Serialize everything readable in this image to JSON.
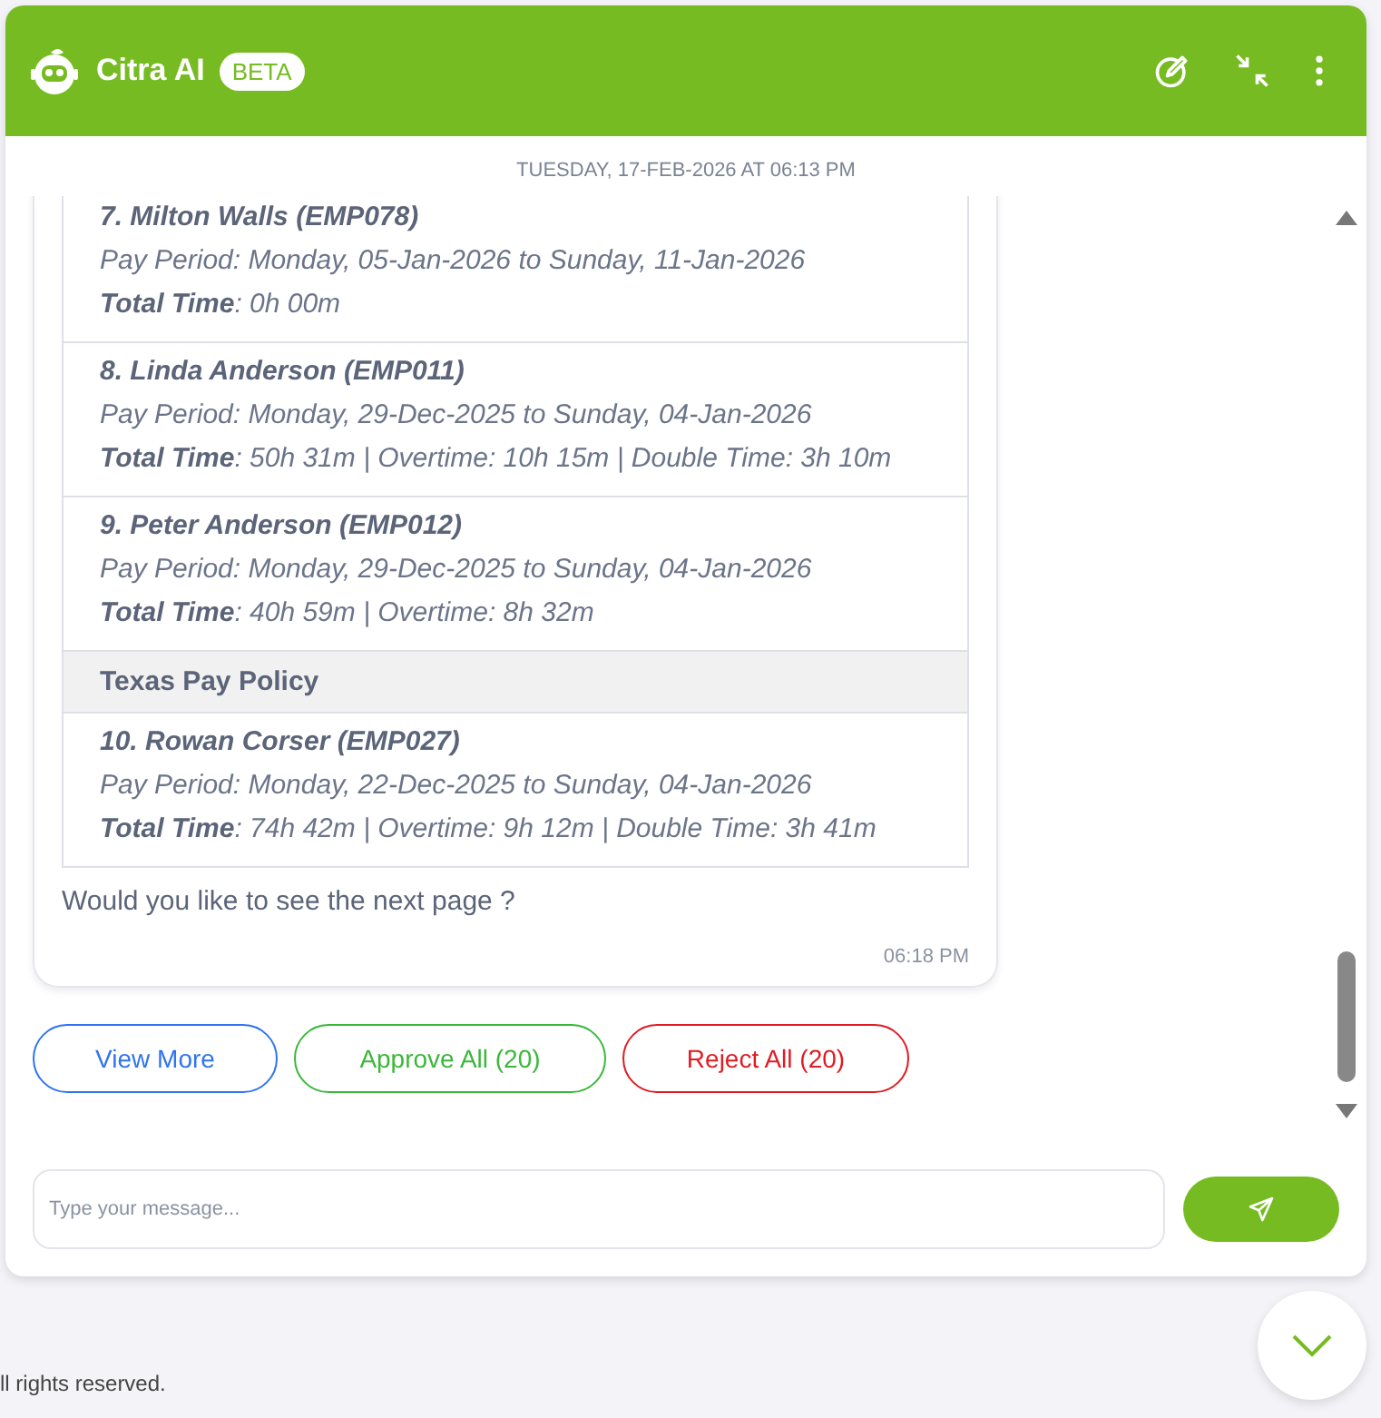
{
  "header": {
    "title": "Citra AI",
    "badge": "BETA"
  },
  "date_divider": "TUESDAY, 17-FEB-2026 AT 06:13 PM",
  "message": {
    "rows": [
      {
        "kind": "employee",
        "name": "7. Milton Walls (EMP078)",
        "period": "Pay Period: Monday, 05-Jan-2026 to Sunday, 11-Jan-2026",
        "total": "**Total Time**: 0h 00m"
      },
      {
        "kind": "employee",
        "name": "8. Linda Anderson (EMP011)",
        "period": "Pay Period: Monday, 29-Dec-2025 to Sunday, 04-Jan-2026",
        "total": "**Total Time**: 50h 31m | Overtime: 10h 15m | Double Time: 3h 10m"
      },
      {
        "kind": "employee",
        "name": "9. Peter Anderson (EMP012)",
        "period": "Pay Period: Monday, 29-Dec-2025 to Sunday, 04-Jan-2026",
        "total": "**Total Time**: 40h 59m | Overtime: 8h 32m"
      },
      {
        "kind": "policy",
        "name": "Texas Pay Policy"
      },
      {
        "kind": "employee",
        "name": "10. Rowan Corser (EMP027)",
        "period": "Pay Period: Monday, 22-Dec-2025 to Sunday, 04-Jan-2026",
        "total": "**Total Time**: 74h 42m | Overtime: 9h 12m | Double Time: 3h 41m"
      }
    ],
    "question": "Would you like to see the next page ?",
    "time": "06:18 PM"
  },
  "actions": [
    {
      "label": "View More",
      "kind": "view"
    },
    {
      "label": "Approve All (20)",
      "kind": "approve"
    },
    {
      "label": "Reject All (20)",
      "kind": "reject"
    }
  ],
  "composer": {
    "placeholder": "Type your message..."
  },
  "footer": "ll rights reserved."
}
